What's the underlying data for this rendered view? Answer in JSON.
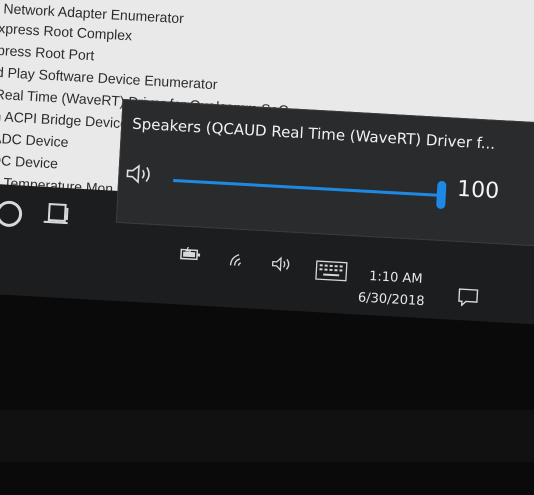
{
  "device_manager": {
    "items": [
      "Network Adapter Enumerator",
      "xpress Root Complex",
      "press Root Port",
      "d Play Software Device Enumerator",
      "Real Time (WaveRT) Driver for Qualcomm SoC",
      "n ACPI Bridge Device",
      "ADC Device",
      "DC Device",
      "C Temperature Mon"
    ]
  },
  "volume_flyout": {
    "title": "Speakers (QCAUD Real Time (WaveRT) Driver f...",
    "volume_percent": 100,
    "volume_label": "100",
    "accent_color": "#1e88e5"
  },
  "tray": {
    "icons": [
      "battery-icon",
      "wifi-icon",
      "speaker-icon",
      "keyboard-icon"
    ],
    "time": "1:10 AM",
    "date": "6/30/2018",
    "notification_icon": "action-center-icon"
  },
  "taskbar": {
    "icons": [
      "search-icon",
      "task-view-icon"
    ]
  }
}
